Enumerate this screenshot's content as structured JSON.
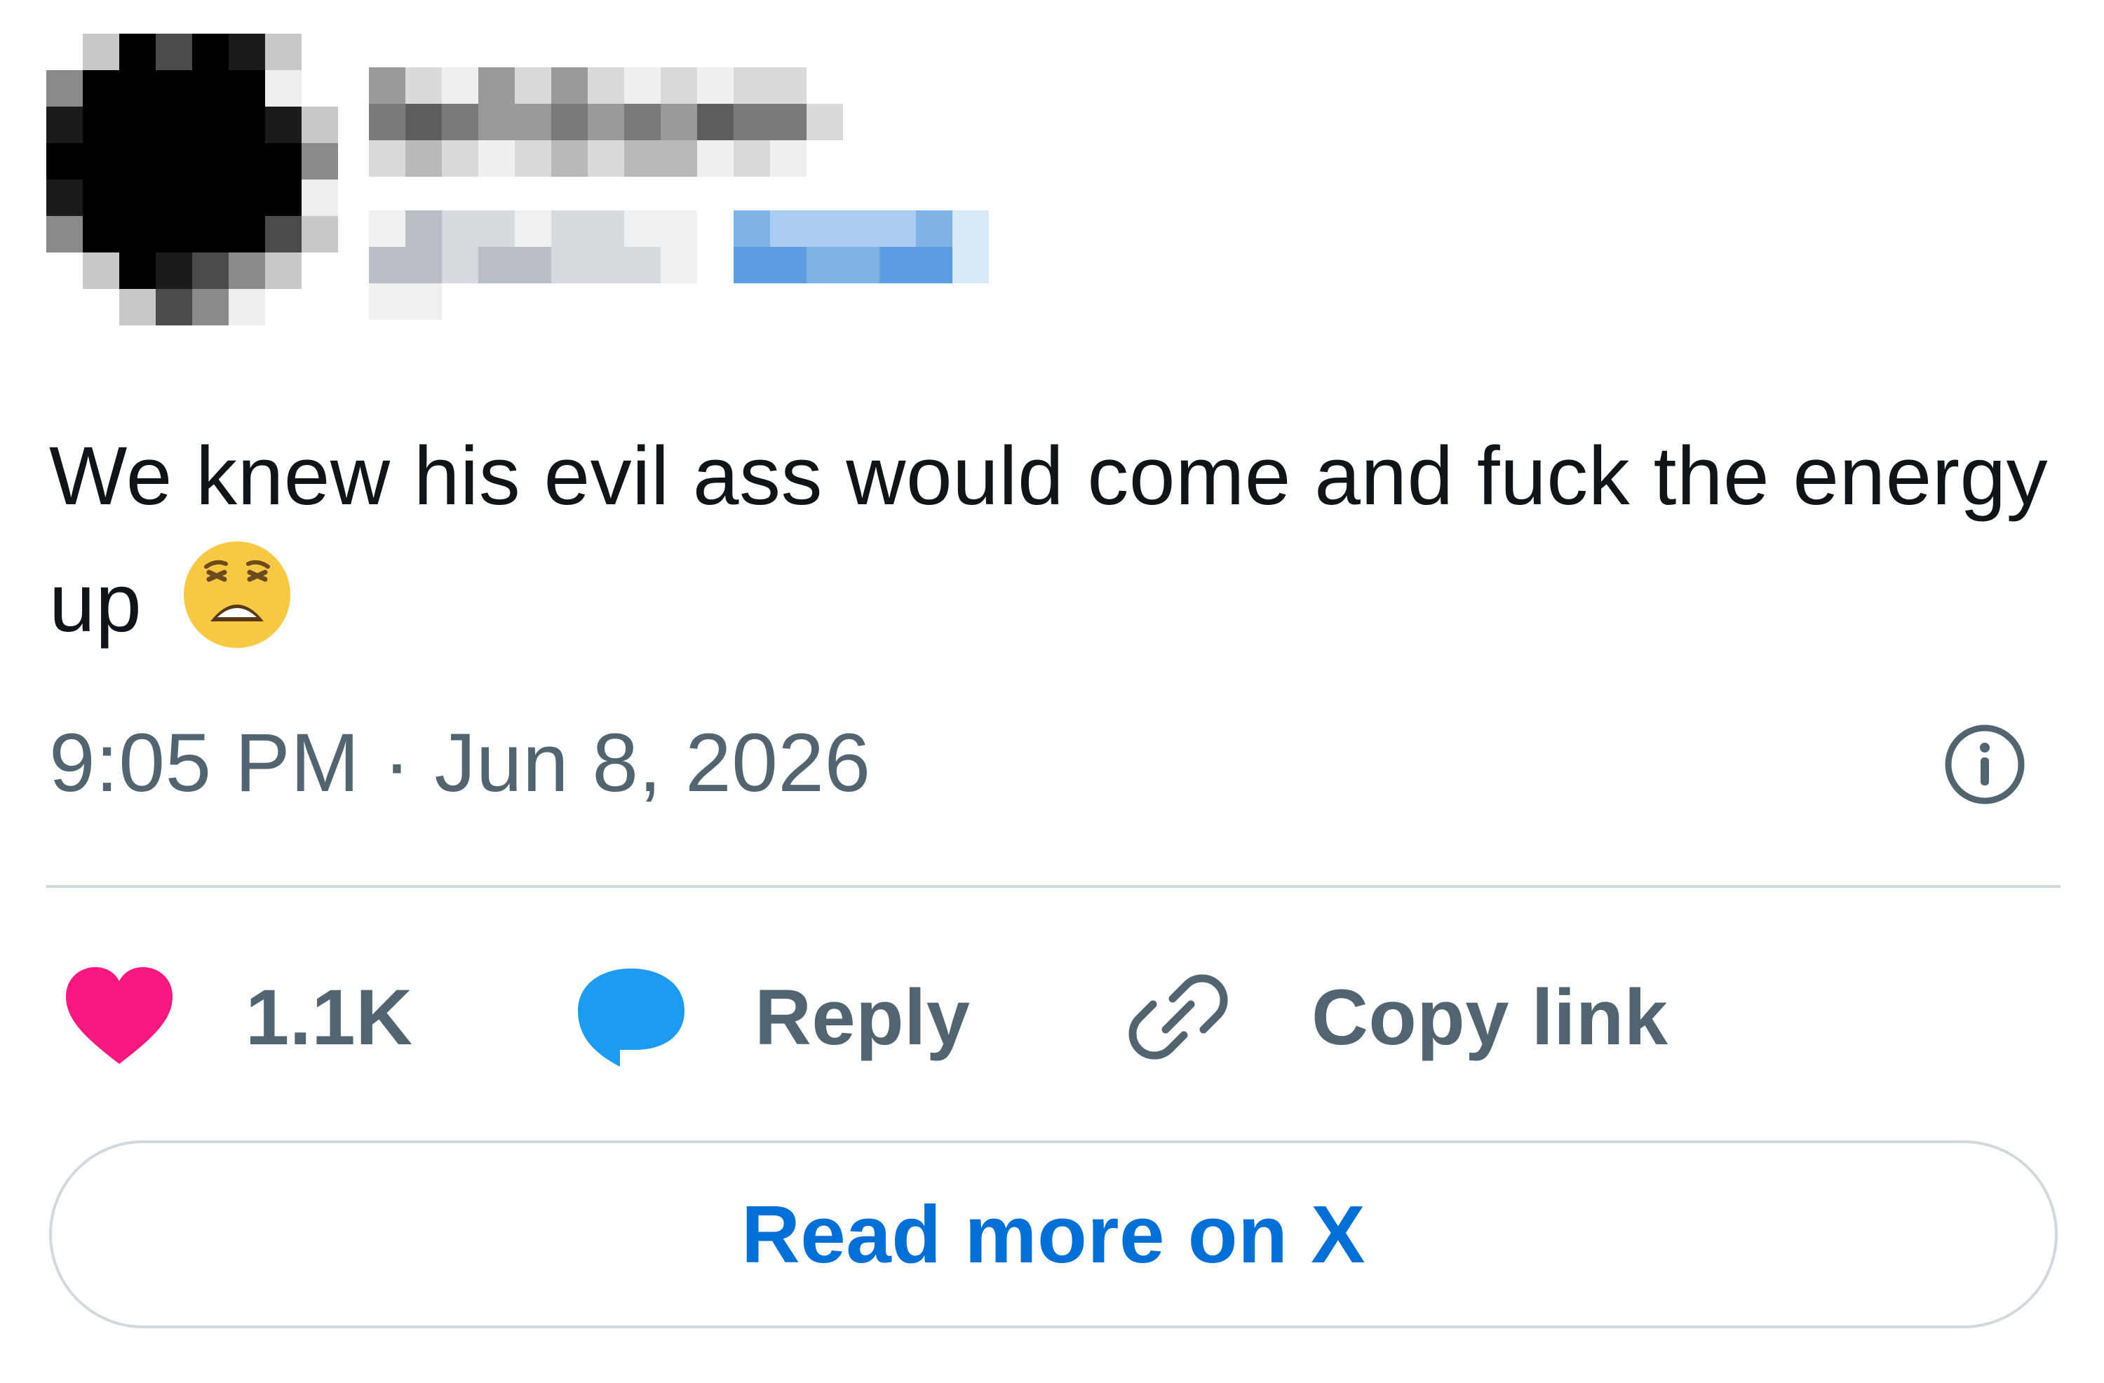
{
  "tweet": {
    "text": "We knew his evil ass would come and fuck the energy up",
    "emoji": "😩",
    "time": "9:05 PM",
    "separator": "·",
    "date": "Jun 8, 2026"
  },
  "actions": {
    "likes": "1.1K",
    "reply_label": "Reply",
    "copy_label": "Copy link"
  },
  "read_more_label": "Read more on X",
  "colors": {
    "like": "#f91880",
    "reply": "#1d9bf0",
    "link_text": "#006fd6",
    "muted": "#536471",
    "divider": "#cfd9de"
  },
  "icons": {
    "like": "heart-icon",
    "reply": "speech-bubble-icon",
    "copy": "link-icon",
    "info": "info-icon"
  }
}
